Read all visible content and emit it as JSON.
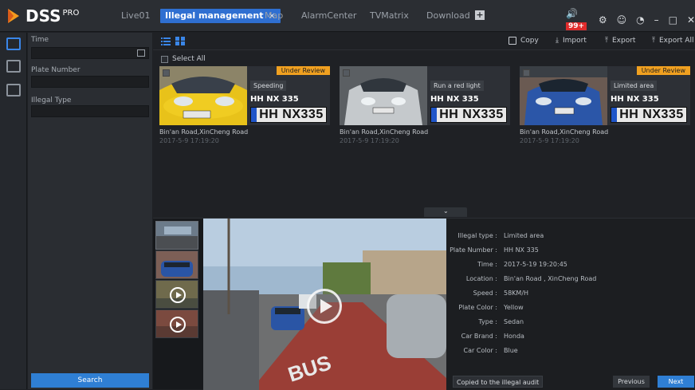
{
  "app": {
    "name": "DSS",
    "sup": "PRO"
  },
  "tabs": [
    {
      "label": "Live01"
    },
    {
      "label": "Illegal management",
      "close": "×"
    },
    {
      "label": "Map"
    },
    {
      "label": "AlarmCenter"
    },
    {
      "label": "TVMatrix"
    },
    {
      "label": "Download"
    }
  ],
  "topbar": {
    "alarm_count": "99+",
    "plus": "+"
  },
  "filters": {
    "time_label": "Time",
    "plate_label": "Plate Number",
    "type_label": "Illegal Type",
    "search_label": "Search"
  },
  "toolbar": {
    "copy": "Copy",
    "import": "Import",
    "export": "Export",
    "export_all": "Export All"
  },
  "select_all": "Select All",
  "cards": [
    {
      "review": "Under Review",
      "type": "Speeding",
      "plate": "HH NX 335",
      "plate_img": "HH NX335",
      "location": "Bin'an Road,XinCheng Road",
      "time": "2017-5-9 17:19:20"
    },
    {
      "review": "",
      "type": "Run a red light",
      "plate": "HH NX 335",
      "plate_img": "HH NX335",
      "location": "Bin'an Road,XinCheng Road",
      "time": "2017-5-9 17:19:20"
    },
    {
      "review": "Under Review",
      "type": "Limited area",
      "plate": "HH NX 335",
      "plate_img": "HH NX335",
      "location": "Bin'an Road,XinCheng Road",
      "time": "2017-5-9 17:19:20"
    }
  ],
  "details": {
    "illegal_type": {
      "k": "Illegal type :",
      "v": "Limited area"
    },
    "plate_number": {
      "k": "Plate Number :",
      "v": "HH NX 335"
    },
    "time": {
      "k": "Time :",
      "v": "2017-5-19 19:20:45"
    },
    "location": {
      "k": "Location :",
      "v": "Bin'an  Road , XinCheng Road"
    },
    "speed": {
      "k": "Speed :",
      "v": "58KM/H"
    },
    "plate_color": {
      "k": "Plate Color :",
      "v": "Yellow"
    },
    "type": {
      "k": "Type :",
      "v": "Sedan"
    },
    "car_brand": {
      "k": "Car Brand :",
      "v": "Honda"
    },
    "car_color": {
      "k": "Car Color :",
      "v": "Blue"
    }
  },
  "actions": {
    "copied": "Copied to the illegal audit",
    "previous": "Previous",
    "next": "Next"
  },
  "colors": {
    "accent": "#2f7fd4",
    "review": "#f0a020",
    "alarm": "#e02b2b"
  }
}
